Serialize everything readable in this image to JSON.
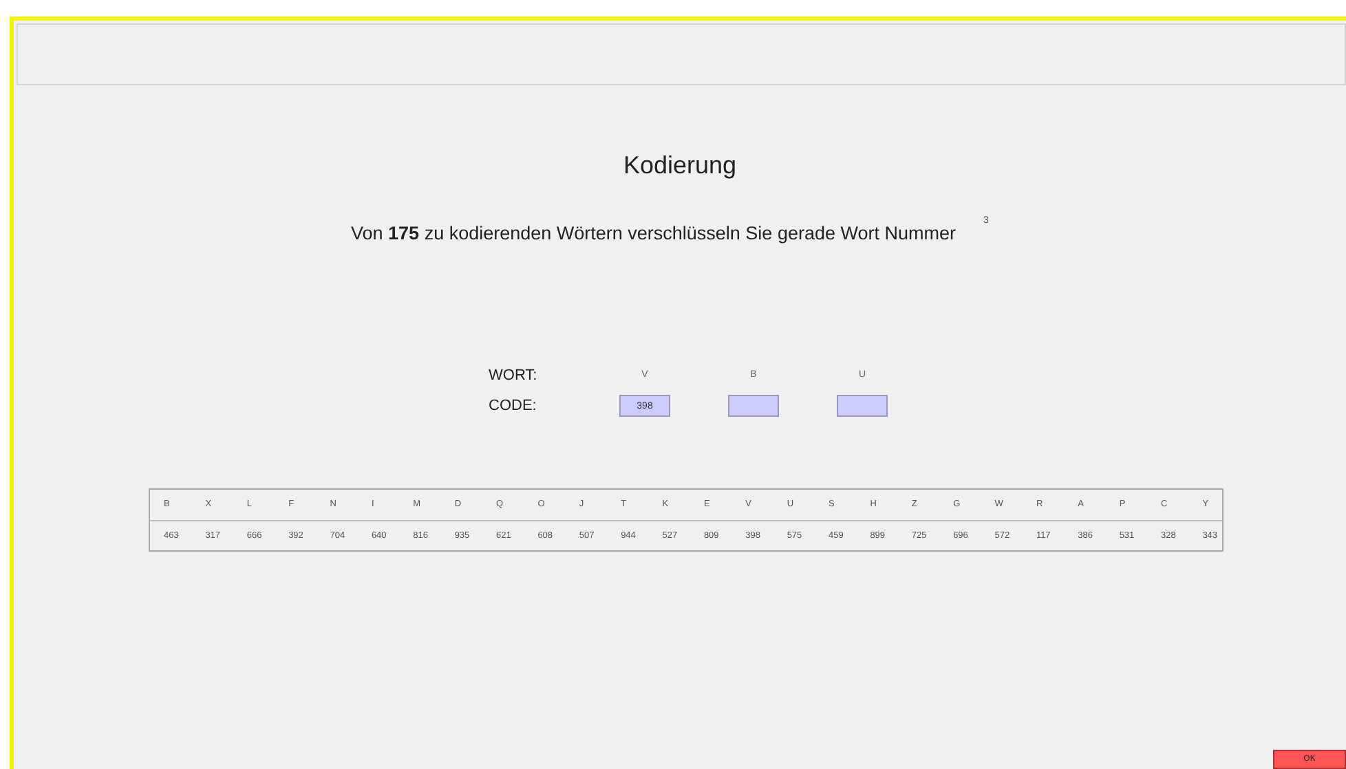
{
  "title": "Kodierung",
  "sentence": "Von **175** zu kodierenden Wörtern verschlüsseln Sie gerade Wort Nummer",
  "word_number": "3",
  "word_label": "WORT:",
  "code_label": "CODE:",
  "word_letters": [
    "V",
    "B",
    "U"
  ],
  "code_fields": [
    {
      "filled": true,
      "value": "398"
    },
    {
      "filled": false
    },
    {
      "filled": false
    }
  ],
  "table": {
    "letters": [
      "B",
      "X",
      "L",
      "F",
      "N",
      "I",
      "M",
      "D",
      "Q",
      "O",
      "J",
      "T",
      "K",
      "E",
      "V",
      "U",
      "S",
      "H",
      "Z",
      "G",
      "W",
      "R",
      "A",
      "P",
      "C",
      "Y"
    ],
    "codes": [
      "463",
      "317",
      "666",
      "392",
      "704",
      "640",
      "816",
      "935",
      "621",
      "608",
      "507",
      "944",
      "527",
      "809",
      "398",
      "575",
      "459",
      "899",
      "725",
      "696",
      "572",
      "117",
      "386",
      "531",
      "328",
      "343"
    ]
  },
  "ok_button": "OK"
}
